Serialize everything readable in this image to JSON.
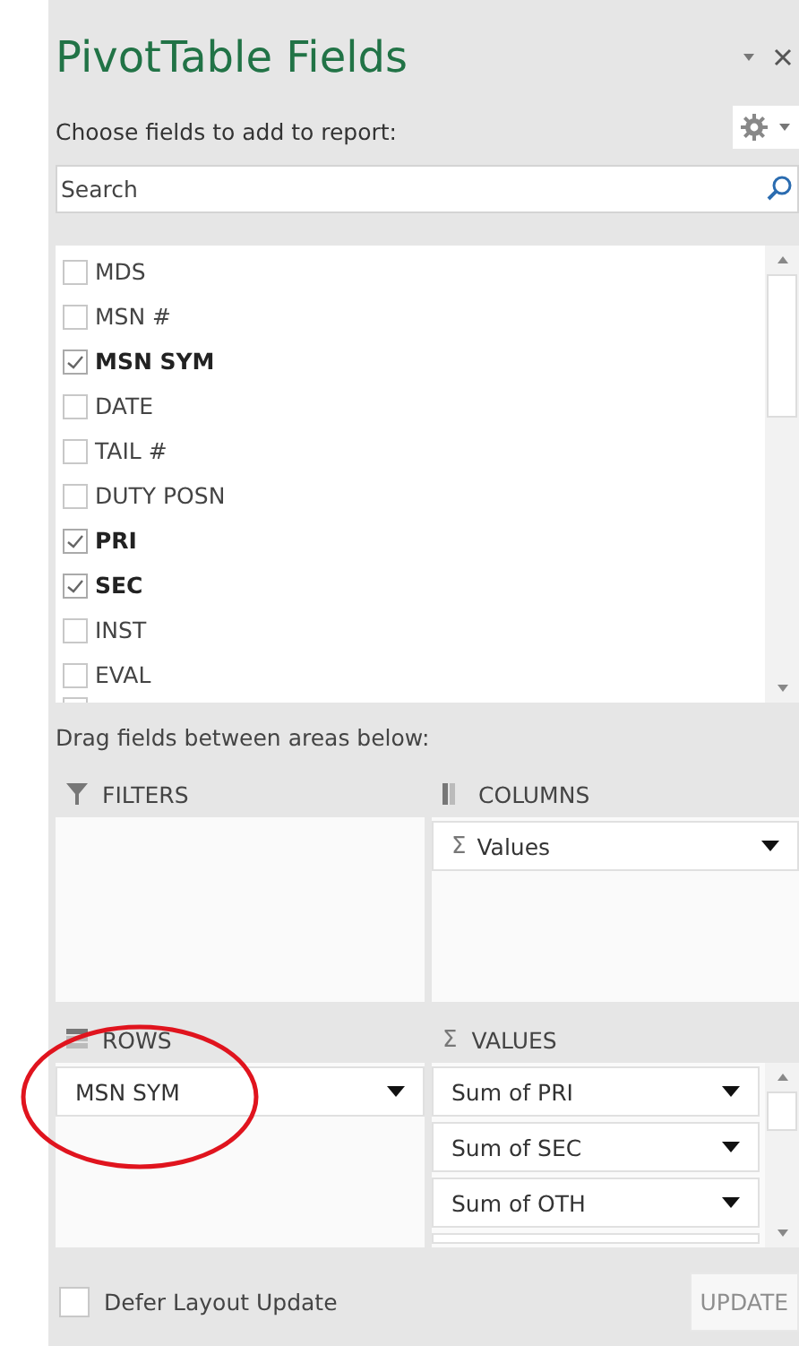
{
  "title": "PivotTable Fields",
  "subtitle": "Choose fields to add to report:",
  "search": {
    "placeholder": "Search"
  },
  "fields": [
    {
      "label": "MDS",
      "checked": false
    },
    {
      "label": "MSN #",
      "checked": false
    },
    {
      "label": "MSN SYM",
      "checked": true
    },
    {
      "label": "DATE",
      "checked": false
    },
    {
      "label": "TAIL #",
      "checked": false
    },
    {
      "label": "DUTY POSN",
      "checked": false
    },
    {
      "label": "PRI",
      "checked": true
    },
    {
      "label": "SEC",
      "checked": true
    },
    {
      "label": "INST",
      "checked": false
    },
    {
      "label": "EVAL",
      "checked": false
    }
  ],
  "drag_hint": "Drag fields between areas below:",
  "areas": [
    {
      "kind": "filters",
      "label": "FILTERS"
    },
    {
      "kind": "columns",
      "label": "COLUMNS",
      "items": [
        {
          "symbol": "Σ",
          "label": "Values"
        }
      ]
    },
    {
      "kind": "rows",
      "label": "ROWS",
      "items": [
        {
          "label": "MSN SYM"
        }
      ]
    },
    {
      "kind": "values",
      "symbol": "Σ",
      "label": "VALUES",
      "items": [
        {
          "label": "Sum of PRI"
        },
        {
          "label": "Sum of SEC"
        },
        {
          "label": "Sum of OTH"
        }
      ]
    }
  ],
  "defer": {
    "label": "Defer Layout Update",
    "checked": false
  },
  "update_button": {
    "label": "UPDATE",
    "disabled": true
  },
  "annotation": {
    "kind": "ellipse"
  }
}
